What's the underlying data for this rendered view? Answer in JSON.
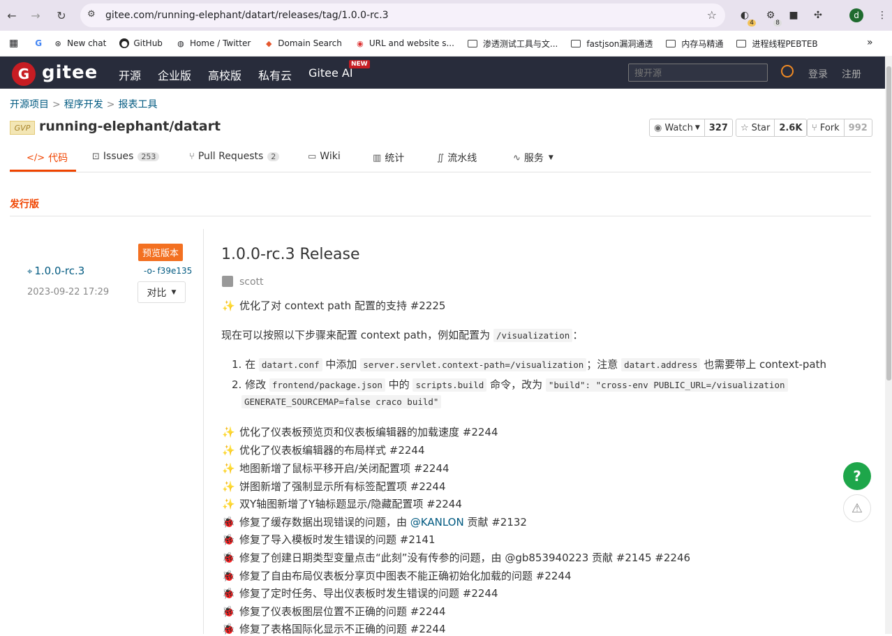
{
  "browser": {
    "url": "gitee.com/running-elephant/datart/releases/tag/1.0.0-rc.3",
    "ext_badge_1": "4",
    "ext_badge_2": "8",
    "profile_initial": "d",
    "bookmarks": [
      {
        "label": "New chat",
        "icon": "openai-icon"
      },
      {
        "label": "GitHub",
        "icon": "github-icon"
      },
      {
        "label": "Home / Twitter",
        "icon": "globe-icon"
      },
      {
        "label": "Domain Search",
        "icon": "domain-icon"
      },
      {
        "label": "URL and website s...",
        "icon": "url-icon"
      },
      {
        "label": "渗透测试工具与文...",
        "icon": "folder-icon"
      },
      {
        "label": "fastjson漏洞通透",
        "icon": "folder-icon"
      },
      {
        "label": "内存马精通",
        "icon": "folder-icon"
      },
      {
        "label": "进程线程PEBTEB",
        "icon": "folder-icon"
      }
    ]
  },
  "gitee_header": {
    "logo": "gitee",
    "logo_letter": "G",
    "nav": [
      "开源",
      "企业版",
      "高校版",
      "私有云",
      "Gitee AI"
    ],
    "new_badge": "NEW",
    "search_placeholder": "搜开源",
    "login": "登录",
    "register": "注册"
  },
  "project": {
    "breadcrumb": [
      "开源项目",
      "程序开发",
      "报表工具"
    ],
    "gvp": "GVP",
    "title": "running-elephant/datart",
    "watch": {
      "label": "Watch",
      "count": "327"
    },
    "star": {
      "label": "Star",
      "count": "2.6K"
    },
    "fork": {
      "label": "Fork",
      "count": "992"
    },
    "tabs": [
      {
        "label": "代码"
      },
      {
        "label": "Issues",
        "count": "253"
      },
      {
        "label": "Pull Requests",
        "count": "2"
      },
      {
        "label": "Wiki"
      },
      {
        "label": "统计"
      },
      {
        "label": "流水线"
      },
      {
        "label": "服务"
      }
    ]
  },
  "release": {
    "section_title": "发行版",
    "prerelease_badge": "预览版本",
    "tag": "1.0.0-rc.3",
    "commit": "f39e135",
    "date": "2023-09-22 17:29",
    "compare": "对比",
    "title": "1.0.0-rc.3 Release",
    "author": "scott",
    "notes": {
      "n1": {
        "emoji": "✨",
        "text": "优化了对 context path 配置的支持 #2225"
      },
      "n2": {
        "pre": "现在可以按照以下步骤来配置 context path，例如配置为 ",
        "code": "/visualization",
        "post": "："
      },
      "step1": {
        "a": "1. 在 ",
        "c1": "datart.conf",
        "b": " 中添加 ",
        "c2": "server.servlet.context-path=/visualization",
        "c": "；注意 ",
        "c3": "datart.address",
        "d": " 也需要带上 context-path"
      },
      "step2": {
        "a": "2. 修改 ",
        "c1": "frontend/package.json",
        "b": " 中的 ",
        "c2": "scripts.build",
        "c": " 命令，改为 ",
        "c3": "\"build\": \"cross-env PUBLIC_URL=/visualization",
        "c4": "GENERATE_SOURCEMAP=false craco build\""
      },
      "items": [
        {
          "emoji": "✨",
          "text": "优化了仪表板预览页和仪表板编辑器的加载速度 #2244"
        },
        {
          "emoji": "✨",
          "text": "优化了仪表板编辑器的布局样式 #2244"
        },
        {
          "emoji": "✨",
          "text": "地图新增了鼠标平移开启/关闭配置项 #2244"
        },
        {
          "emoji": "✨",
          "text": "饼图新增了强制显示所有标签配置项 #2244"
        },
        {
          "emoji": "✨",
          "text": "双Y轴图新增了Y轴标题显示/隐藏配置项 #2244"
        },
        {
          "emoji": "🐞",
          "pre": "修复了缓存数据出现错误的问题，由 ",
          "at": "@KANLON",
          "post": " 贡献 #2132"
        },
        {
          "emoji": "🐞",
          "text": "修复了导入模板时发生错误的问题 #2141"
        },
        {
          "emoji": "🐞",
          "text": "修复了创建日期类型变量点击“此刻”没有传参的问题，由 @gb853940223 贡献 #2145 #2246"
        },
        {
          "emoji": "🐞",
          "text": "修复了自由布局仪表板分享页中图表不能正确初始化加载的问题 #2244"
        },
        {
          "emoji": "🐞",
          "text": "修复了定时任务、导出仪表板时发生错误的问题 #2244"
        },
        {
          "emoji": "🐞",
          "text": "修复了仪表板图层位置不正确的问题 #2244"
        },
        {
          "emoji": "🐞",
          "text": "修复了表格国际化显示不正确的问题 #2244"
        }
      ]
    }
  },
  "floating": {
    "help": "?",
    "warn": "⚠"
  }
}
